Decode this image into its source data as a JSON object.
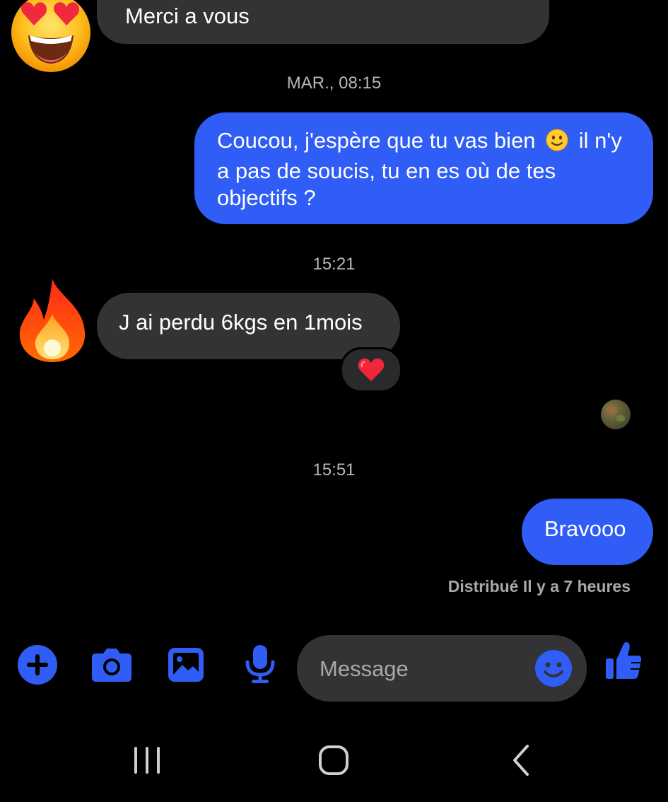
{
  "conversation": {
    "messages": [
      {
        "id": "m1",
        "direction": "incoming",
        "text": "Merci a vous"
      },
      {
        "id": "m2",
        "direction": "outgoing",
        "lines": [
          "Coucou, j'espère que tu vas bien",
          "il n'y",
          "a pas de soucis, tu en es où de tes",
          "objectifs ?"
        ]
      },
      {
        "id": "m3",
        "direction": "incoming",
        "text": "J ai perdu 6kgs en 1mois",
        "reaction": "heart"
      },
      {
        "id": "m4",
        "direction": "outgoing",
        "text": "Bravooo"
      }
    ],
    "timestamps": [
      "MAR., 08:15",
      "15:21",
      "15:51"
    ],
    "delivery_status": "Distribué Il y a 7 heures"
  },
  "avatars": {
    "m1": "heart-eyes-emoji",
    "m3": "fire-emoji"
  },
  "composer": {
    "placeholder": "Message",
    "icons": [
      "plus-icon",
      "camera-icon",
      "image-icon",
      "microphone-icon",
      "emoji-icon",
      "thumbs-up-icon"
    ]
  },
  "colors": {
    "accent": "#2f5df5",
    "bubble_incoming": "#333335",
    "background": "#000000",
    "status_text": "#a8a8a8"
  },
  "navbar": {
    "icons": [
      "recents-icon",
      "home-icon",
      "back-icon"
    ]
  }
}
